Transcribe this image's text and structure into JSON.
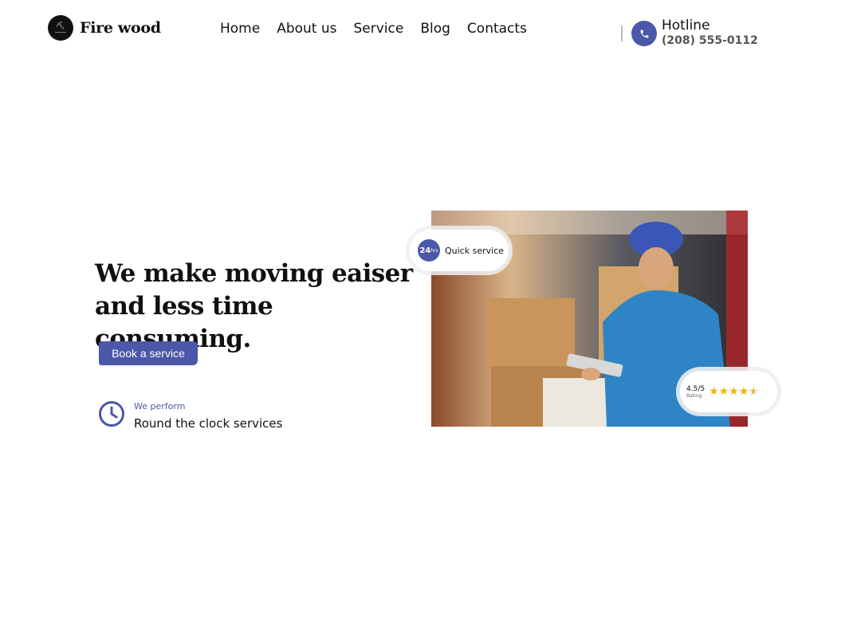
{
  "header": {
    "brand": "Fire wood",
    "logo_icon": "firewood-logo-icon",
    "nav": [
      {
        "label": "Home"
      },
      {
        "label": "About us"
      },
      {
        "label": "Service"
      },
      {
        "label": "Blog"
      },
      {
        "label": "Contacts"
      }
    ],
    "hotline_title": "Hotline",
    "hotline_number": "(208) 555-0112",
    "phone_icon": "phone-icon"
  },
  "hero": {
    "title_line1": "We make moving eaiser",
    "title_line2": "and less time consuming.",
    "cta_label": "Book a service",
    "feature_label": "We perform",
    "feature_text": "Round the clock services",
    "feature_icon": "clock-icon"
  },
  "badges": {
    "quick_number": "24",
    "quick_unit": "hrs",
    "quick_label": "Quick service",
    "rating_value": "4.5/5",
    "rating_label": "Rating",
    "rating_stars": 4.5
  },
  "colors": {
    "accent": "#4b57a8",
    "star": "#f5b400",
    "text": "#111111"
  }
}
